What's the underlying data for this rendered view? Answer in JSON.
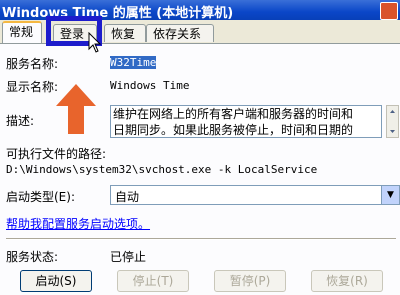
{
  "window": {
    "title": "Windows Time 的属性 (本地计算机)"
  },
  "tabs": [
    {
      "label": "常规"
    },
    {
      "label": "登录"
    },
    {
      "label": "恢复"
    },
    {
      "label": "依存关系"
    }
  ],
  "general": {
    "service_name_label": "服务名称:",
    "service_name_value": "W32Time",
    "display_name_label": "显示名称:",
    "display_name_value": "Windows Time",
    "description_label": "描述:",
    "description_line1": "维护在网络上的所有客户端和服务器的时间和",
    "description_line2": "日期同步。如果此服务被停止，时间和日期的",
    "exe_path_label": "可执行文件的路径:",
    "exe_path_value": "D:\\Windows\\system32\\svchost.exe -k LocalService",
    "startup_type_label": "启动类型(E):",
    "startup_type_value": "自动",
    "help_link": "帮助我配置服务启动选项。",
    "status_label": "服务状态:",
    "status_value": "已停止"
  },
  "buttons": {
    "start": "启动(S)",
    "stop": "停止(T)",
    "pause": "暂停(P)",
    "resume": "恢复(R)"
  },
  "colors": {
    "highlight_box": "#1d1ccc",
    "annotation_arrow": "#e8642c",
    "titlebar": "#0a46c8"
  }
}
